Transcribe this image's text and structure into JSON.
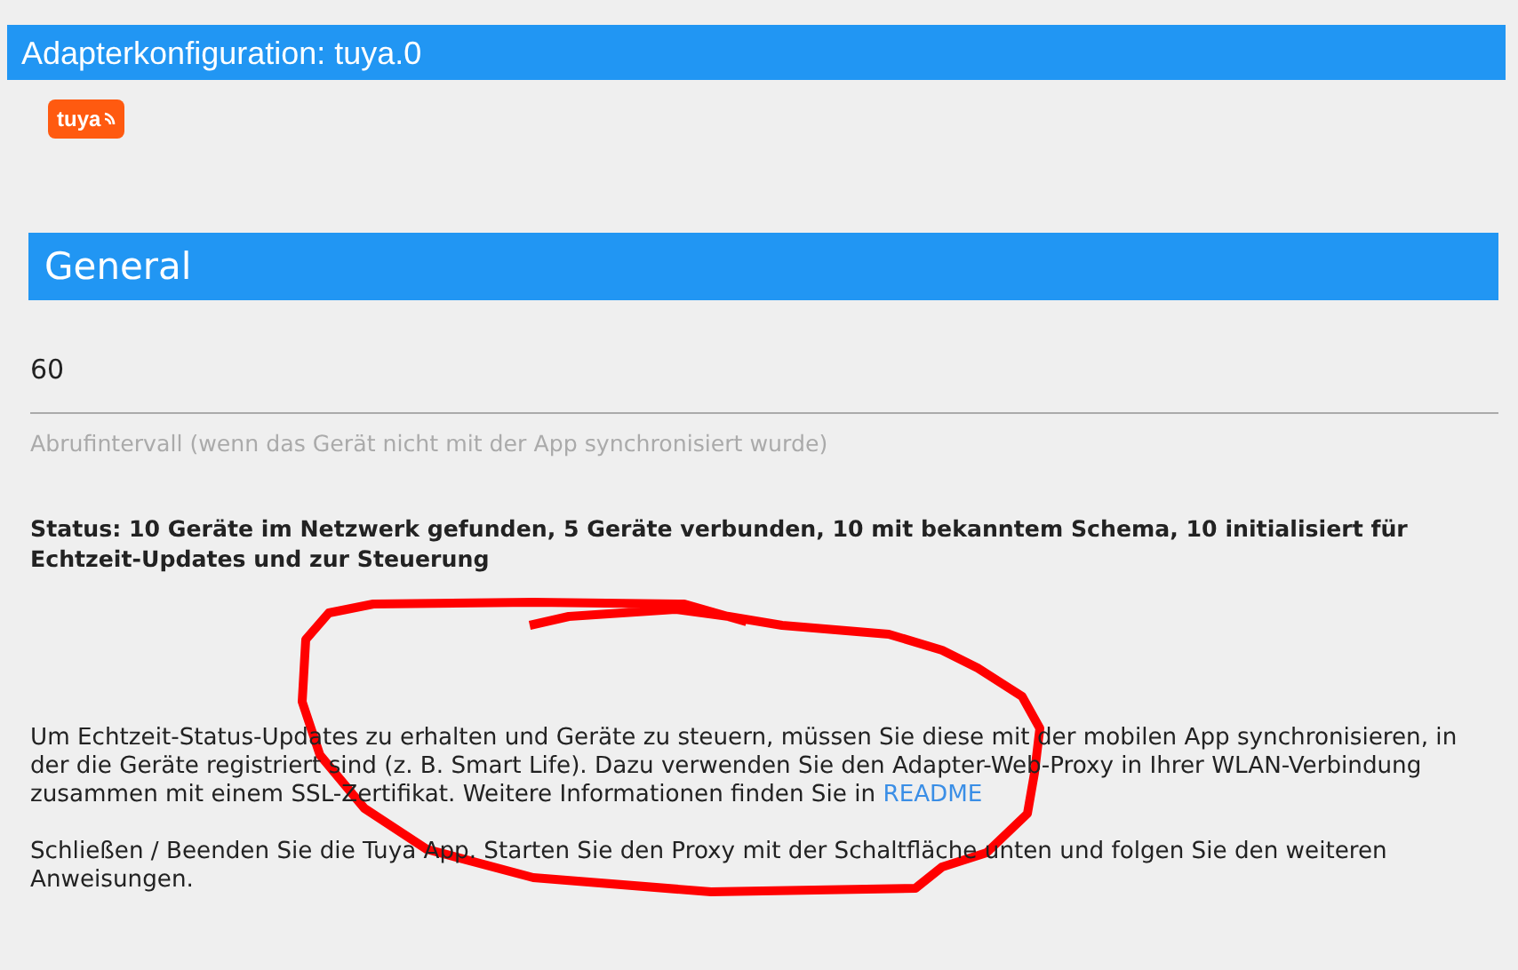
{
  "window": {
    "title": "Adapterkonfiguration: tuya.0"
  },
  "logo": {
    "text": "tuya"
  },
  "section": {
    "title": "General"
  },
  "poll_interval": {
    "value": "60",
    "hint": "Abrufintervall (wenn das Gerät nicht mit der App synchronisiert wurde)"
  },
  "status": "Status: 10 Geräte im Netzwerk gefunden, 5 Geräte verbunden, 10 mit bekanntem Schema, 10 initialisiert für Echtzeit-Updates und zur Steuerung",
  "instructions": [
    {
      "text": "Um Echtzeit-Status-Updates zu erhalten und Geräte zu steuern, müssen Sie diese mit der mobilen App synchronisieren, in der die Geräte registriert sind (z. B. Smart Life). Dazu verwenden Sie den Adapter-Web-Proxy in Ihrer WLAN-Verbindung zusammen mit einem SSL-Zertifikat. Weitere Informationen finden Sie in",
      "link": "README"
    },
    {
      "text": "Schließen / Beenden Sie die Tuya App. Starten Sie den Proxy mit der Schaltfläche unten und folgen Sie den weiteren Anweisungen."
    }
  ],
  "annotation": {
    "kind": "freehand-circle"
  }
}
